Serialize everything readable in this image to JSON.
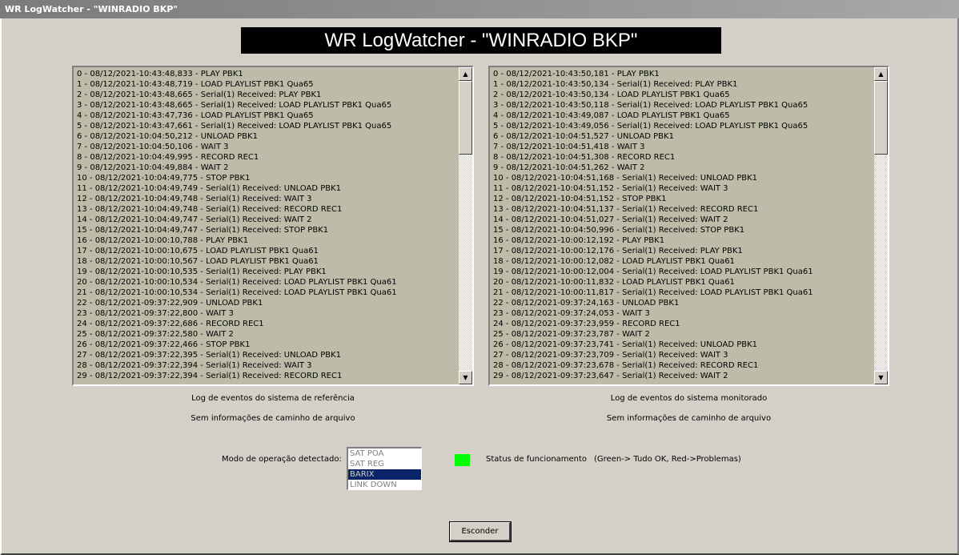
{
  "window": {
    "title": "WR LogWatcher - \"WINRADIO BKP\""
  },
  "banner": {
    "title": "WR LogWatcher - \"WINRADIO BKP\""
  },
  "left_log": {
    "lines": [
      "0 - 08/12/2021-10:43:48,833 - PLAY PBK1",
      "1 - 08/12/2021-10:43:48,719 - LOAD PLAYLIST PBK1 Qua65",
      "2 - 08/12/2021-10:43:48,665 - Serial(1) Received: PLAY PBK1",
      "3 - 08/12/2021-10:43:48,665 - Serial(1) Received: LOAD PLAYLIST PBK1 Qua65",
      "4 - 08/12/2021-10:43:47,736 - LOAD PLAYLIST PBK1 Qua65",
      "5 - 08/12/2021-10:43:47,661 - Serial(1) Received: LOAD PLAYLIST PBK1 Qua65",
      "6 - 08/12/2021-10:04:50,212 - UNLOAD PBK1",
      "7 - 08/12/2021-10:04:50,106 - WAIT 3",
      "8 - 08/12/2021-10:04:49,995 - RECORD REC1",
      "9 - 08/12/2021-10:04:49,884 - WAIT 2",
      "10 - 08/12/2021-10:04:49,775 - STOP PBK1",
      "11 - 08/12/2021-10:04:49,749 - Serial(1) Received: UNLOAD PBK1",
      "12 - 08/12/2021-10:04:49,748 - Serial(1) Received: WAIT 3",
      "13 - 08/12/2021-10:04:49,748 - Serial(1) Received: RECORD REC1",
      "14 - 08/12/2021-10:04:49,747 - Serial(1) Received: WAIT 2",
      "15 - 08/12/2021-10:04:49,747 - Serial(1) Received: STOP PBK1",
      "16 - 08/12/2021-10:00:10,788 - PLAY PBK1",
      "17 - 08/12/2021-10:00:10,675 - LOAD PLAYLIST PBK1 Qua61",
      "18 - 08/12/2021-10:00:10,567 - LOAD PLAYLIST PBK1 Qua61",
      "19 - 08/12/2021-10:00:10,535 - Serial(1) Received: PLAY PBK1",
      "20 - 08/12/2021-10:00:10,534 - Serial(1) Received: LOAD PLAYLIST PBK1 Qua61",
      "21 - 08/12/2021-10:00:10,534 - Serial(1) Received: LOAD PLAYLIST PBK1 Qua61",
      "22 - 08/12/2021-09:37:22,909 - UNLOAD PBK1",
      "23 - 08/12/2021-09:37:22,800 - WAIT 3",
      "24 - 08/12/2021-09:37:22,686 - RECORD REC1",
      "25 - 08/12/2021-09:37:22,580 - WAIT 2",
      "26 - 08/12/2021-09:37:22,466 - STOP PBK1",
      "27 - 08/12/2021-09:37:22,395 - Serial(1) Received: UNLOAD PBK1",
      "28 - 08/12/2021-09:37:22,394 - Serial(1) Received: WAIT 3",
      "29 - 08/12/2021-09:37:22,394 - Serial(1) Received: RECORD REC1"
    ],
    "caption": "Log de eventos do sistema de referência",
    "path": "Sem informações de caminho de arquivo"
  },
  "right_log": {
    "lines": [
      "0 - 08/12/2021-10:43:50,181 - PLAY PBK1",
      "1 - 08/12/2021-10:43:50,134 - Serial(1) Received: PLAY PBK1",
      "2 - 08/12/2021-10:43:50,134 - LOAD PLAYLIST PBK1 Qua65",
      "3 - 08/12/2021-10:43:50,118 - Serial(1) Received: LOAD PLAYLIST PBK1 Qua65",
      "4 - 08/12/2021-10:43:49,087 - LOAD PLAYLIST PBK1 Qua65",
      "5 - 08/12/2021-10:43:49,056 - Serial(1) Received: LOAD PLAYLIST PBK1 Qua65",
      "6 - 08/12/2021-10:04:51,527 - UNLOAD PBK1",
      "7 - 08/12/2021-10:04:51,418 - WAIT 3",
      "8 - 08/12/2021-10:04:51,308 - RECORD REC1",
      "9 - 08/12/2021-10:04:51,262 - WAIT 2",
      "10 - 08/12/2021-10:04:51,168 - Serial(1) Received: UNLOAD PBK1",
      "11 - 08/12/2021-10:04:51,152 - Serial(1) Received: WAIT 3",
      "12 - 08/12/2021-10:04:51,152 - STOP PBK1",
      "13 - 08/12/2021-10:04:51,137 - Serial(1) Received: RECORD REC1",
      "14 - 08/12/2021-10:04:51,027 - Serial(1) Received: WAIT 2",
      "15 - 08/12/2021-10:04:50,996 - Serial(1) Received: STOP PBK1",
      "16 - 08/12/2021-10:00:12,192 - PLAY PBK1",
      "17 - 08/12/2021-10:00:12,176 - Serial(1) Received: PLAY PBK1",
      "18 - 08/12/2021-10:00:12,082 - LOAD PLAYLIST PBK1 Qua61",
      "19 - 08/12/2021-10:00:12,004 - Serial(1) Received: LOAD PLAYLIST PBK1 Qua61",
      "20 - 08/12/2021-10:00:11,832 - LOAD PLAYLIST PBK1 Qua61",
      "21 - 08/12/2021-10:00:11,817 - Serial(1) Received: LOAD PLAYLIST PBK1 Qua61",
      "22 - 08/12/2021-09:37:24,163 - UNLOAD PBK1",
      "23 - 08/12/2021-09:37:24,053 - WAIT 3",
      "24 - 08/12/2021-09:37:23,959 - RECORD REC1",
      "25 - 08/12/2021-09:37:23,787 - WAIT 2",
      "26 - 08/12/2021-09:37:23,741 - Serial(1) Received: UNLOAD PBK1",
      "27 - 08/12/2021-09:37:23,709 - Serial(1) Received: WAIT 3",
      "28 - 08/12/2021-09:37:23,678 - Serial(1) Received: RECORD REC1",
      "29 - 08/12/2021-09:37:23,647 - Serial(1) Received: WAIT 2"
    ],
    "caption": "Log de eventos do sistema monitorado",
    "path": "Sem informações de caminho de arquivo"
  },
  "mode": {
    "label": "Modo de operação detectado:",
    "options": [
      "SAT POA",
      "SAT REG",
      "BARIX",
      "LINK DOWN"
    ],
    "selected": "BARIX"
  },
  "status": {
    "label": "Status de funcionamento",
    "legend": "(Green-> Tudo OK, Red->Problemas)",
    "color": "#00ff00"
  },
  "buttons": {
    "hide_label": "Esconder"
  },
  "icons": {
    "scroll_up": "▲",
    "scroll_down": "▼"
  }
}
